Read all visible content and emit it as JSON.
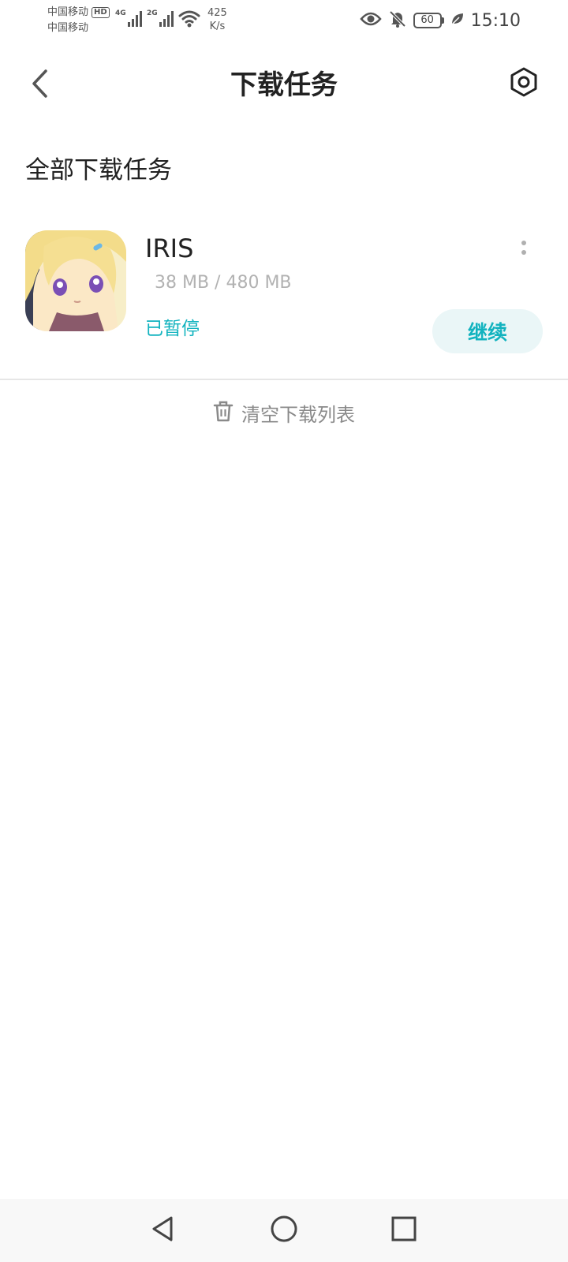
{
  "status_bar": {
    "carrier_1": "中国移动",
    "carrier_1_badge": "HD",
    "carrier_2": "中国移动",
    "network_1": "4G",
    "network_2": "2G",
    "speed_value": "425",
    "speed_unit": "K/s",
    "battery": "60",
    "time": "15:10",
    "icons": [
      "eye-icon",
      "bell-off-icon",
      "battery-icon",
      "leaf-icon"
    ]
  },
  "header": {
    "title": "下载任务",
    "back_icon": "chevron-left-icon",
    "settings_icon": "hexagon-settings-icon"
  },
  "section": {
    "title": "全部下载任务"
  },
  "tasks": [
    {
      "name": "IRIS",
      "size": "38 MB / 480 MB",
      "status": "已暂停",
      "action": "继续",
      "icon": "anime-girl-app-icon",
      "progress_fraction": 0.079
    }
  ],
  "footer_action": {
    "label": "清空下载列表",
    "icon": "trash-icon"
  },
  "colors": {
    "accent": "#12b3bf",
    "button_bg": "#eaf6f7",
    "muted": "#b2b2b2"
  },
  "nav_bar": {
    "icons": [
      "back-triangle-icon",
      "home-circle-icon",
      "recents-square-icon"
    ]
  }
}
